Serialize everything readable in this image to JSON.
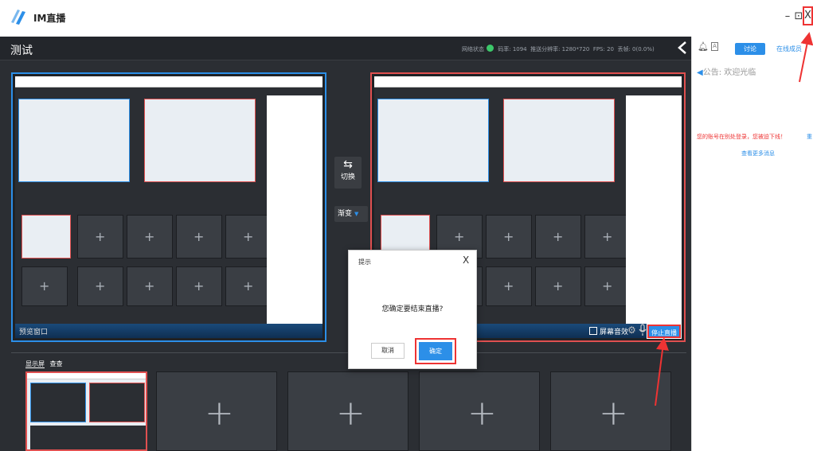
{
  "window": {
    "title": "IM直播",
    "minimize": "–",
    "restore": "⊡",
    "close": "X"
  },
  "topbar": {
    "room_title": "测试",
    "network_label": "网络状态",
    "bitrate": "码率: 1094",
    "resolution": "推送分辨率: 1280*720",
    "fps": "FPS: 20",
    "loss": "丢帧: 0(0.0%)",
    "share_icon": "share-icon"
  },
  "preview": {
    "label": "预览窗口"
  },
  "center": {
    "switch_label": "切换",
    "switch_symbol": "⇆",
    "transition_label": "渐变",
    "transition_arrow": "▼"
  },
  "program": {
    "screen_sound_label": "屏幕音效",
    "stop_label": "停止直播"
  },
  "sources": {
    "tabs": [
      "显示屏",
      "查查"
    ],
    "empty_slot_symbol": "+"
  },
  "dialog": {
    "title": "提示",
    "close": "X",
    "message": "您确定要结束直播?",
    "cancel": "取消",
    "ok": "确定"
  },
  "right_panel": {
    "discuss_tab": "讨论",
    "members_tab": "在线成员",
    "notice": "公告: 欢迎光临",
    "kick_message": "您的账号在别处登录，您被迫下线！",
    "relogin": "重",
    "more_messages": "查看更多消息"
  },
  "colors": {
    "accent": "#2c8fe8",
    "alert": "#e33333",
    "dark_bg": "#2b2e33"
  }
}
